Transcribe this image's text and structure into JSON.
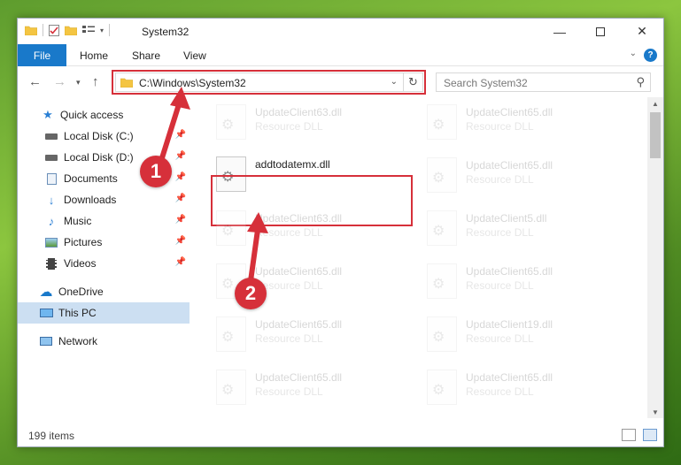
{
  "window": {
    "title": "System32"
  },
  "ribbon": {
    "tabs": [
      "File",
      "Home",
      "Share",
      "View"
    ],
    "help": "?"
  },
  "nav": {
    "address": "C:\\Windows\\System32",
    "search_placeholder": "Search System32"
  },
  "sidebar": {
    "items": [
      {
        "label": "Quick access",
        "icon": "star-icon",
        "pinned": false
      },
      {
        "label": "Local Disk (C:)",
        "icon": "drive-icon",
        "pinned": true
      },
      {
        "label": "Local Disk (D:)",
        "icon": "drive-icon",
        "pinned": true
      },
      {
        "label": "Documents",
        "icon": "documents-icon",
        "pinned": true
      },
      {
        "label": "Downloads",
        "icon": "download-icon",
        "pinned": true
      },
      {
        "label": "Music",
        "icon": "music-icon",
        "pinned": true
      },
      {
        "label": "Pictures",
        "icon": "pictures-icon",
        "pinned": true
      },
      {
        "label": "Videos",
        "icon": "videos-icon",
        "pinned": true
      },
      {
        "label": "OneDrive",
        "icon": "cloud-icon",
        "pinned": false
      },
      {
        "label": "This PC",
        "icon": "computer-icon",
        "pinned": false
      },
      {
        "label": "Network",
        "icon": "network-icon",
        "pinned": false
      }
    ]
  },
  "content": {
    "focus_file": {
      "name": "addtodatemx.dll",
      "type": ""
    },
    "faded_files": [
      {
        "name": "UpdateClient63.dll",
        "type": "Resource DLL"
      },
      {
        "name": "UpdateClient65.dll",
        "type": "Resource DLL"
      },
      {
        "name": "UpdateClient65.dll",
        "type": "Resource DLL"
      },
      {
        "name": "UpdateClient63.dll",
        "type": "Resource DLL"
      },
      {
        "name": "UpdateClient5.dll",
        "type": "Resource DLL"
      },
      {
        "name": "UpdateClient65.dll",
        "type": "Resource DLL"
      },
      {
        "name": "UpdateClient65.dll",
        "type": "Resource DLL"
      },
      {
        "name": "UpdateClient65.dll",
        "type": "Resource DLL"
      },
      {
        "name": "UpdateClient19.dll",
        "type": "Resource DLL"
      },
      {
        "name": "UpdateClient65.dll",
        "type": "Resource DLL"
      },
      {
        "name": "UpdateClient65.dll",
        "type": "Resource DLL"
      }
    ]
  },
  "status": {
    "item_count": "199 items"
  },
  "annotations": {
    "step1": "1",
    "step2": "2",
    "highlight_color": "#d6303a"
  },
  "colors": {
    "accent": "#1979ca",
    "selected": "#ccdff2"
  }
}
